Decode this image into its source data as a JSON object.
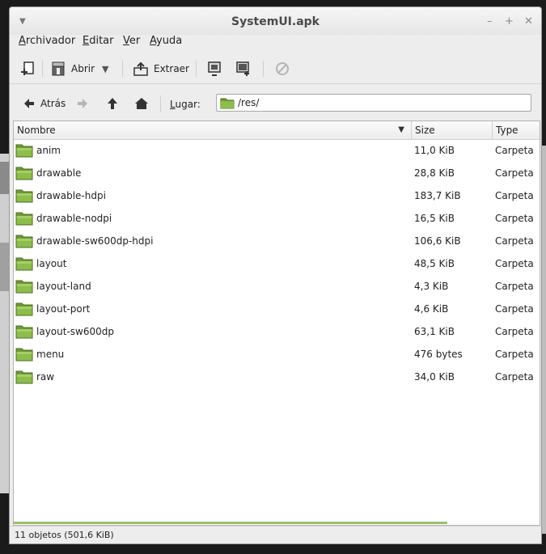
{
  "window": {
    "title": "SystemUI.apk"
  },
  "menubar": {
    "items": [
      {
        "label": "Archivador",
        "mnemonic": "A",
        "rest": "rchivador"
      },
      {
        "label": "Editar",
        "mnemonic": "E",
        "rest": "ditar"
      },
      {
        "label": "Ver",
        "mnemonic": "V",
        "rest": "er"
      },
      {
        "label": "Ayuda",
        "mnemonic": "A",
        "rest": "yuda"
      }
    ]
  },
  "toolbar": {
    "open_label": "Abrir",
    "extract_label": "Extraer"
  },
  "locationbar": {
    "back_label": "Atrás",
    "lugar_mnemonic": "L",
    "lugar_rest": "ugar:",
    "path": "/res/"
  },
  "table": {
    "columns": [
      "Nombre",
      "Size",
      "Type"
    ],
    "rows": [
      {
        "name": "anim",
        "size": "11,0 KiB",
        "type": "Carpeta"
      },
      {
        "name": "drawable",
        "size": "28,8 KiB",
        "type": "Carpeta"
      },
      {
        "name": "drawable-hdpi",
        "size": "183,7 KiB",
        "type": "Carpeta"
      },
      {
        "name": "drawable-nodpi",
        "size": "16,5 KiB",
        "type": "Carpeta"
      },
      {
        "name": "drawable-sw600dp-hdpi",
        "size": "106,6 KiB",
        "type": "Carpeta"
      },
      {
        "name": "layout",
        "size": "48,5 KiB",
        "type": "Carpeta"
      },
      {
        "name": "layout-land",
        "size": "4,3 KiB",
        "type": "Carpeta"
      },
      {
        "name": "layout-port",
        "size": "4,6 KiB",
        "type": "Carpeta"
      },
      {
        "name": "layout-sw600dp",
        "size": "63,1 KiB",
        "type": "Carpeta"
      },
      {
        "name": "menu",
        "size": "476 bytes",
        "type": "Carpeta"
      },
      {
        "name": "raw",
        "size": "34,0 KiB",
        "type": "Carpeta"
      }
    ]
  },
  "status": {
    "text": "11 objetos (501,6 KiB)"
  },
  "colors": {
    "folder_green": "#7fae3a",
    "progress": "#9bbf6a"
  }
}
